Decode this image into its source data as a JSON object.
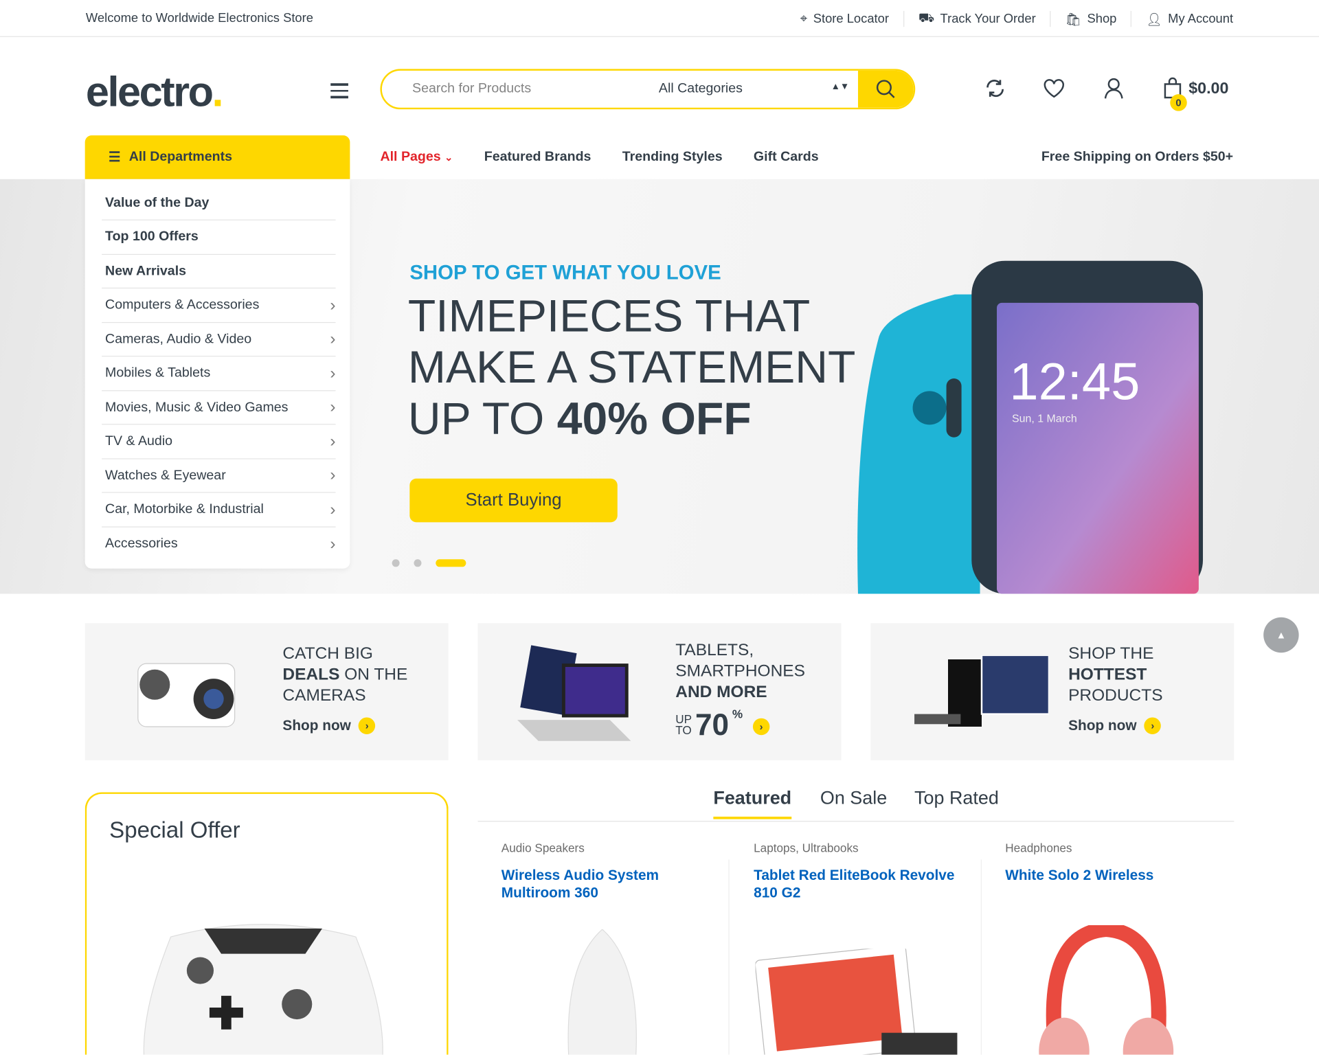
{
  "topbar": {
    "welcome": "Welcome to Worldwide Electronics Store",
    "links": [
      {
        "label": "Store Locator",
        "icon": "map-pin-icon"
      },
      {
        "label": "Track Your Order",
        "icon": "truck-icon"
      },
      {
        "label": "Shop",
        "icon": "shopping-bag-icon"
      },
      {
        "label": "My Account",
        "icon": "user-icon"
      }
    ]
  },
  "header": {
    "logo": "electro",
    "search_placeholder": "Search for Products",
    "category": "All Categories",
    "cart_total": "$0.00",
    "cart_count": "0"
  },
  "nav": {
    "departments": "All Departments",
    "items": [
      "All Pages",
      "Featured Brands",
      "Trending Styles",
      "Gift Cards"
    ],
    "free_shipping": "Free Shipping on Orders $50+"
  },
  "menu": [
    "Value of the Day",
    "Top 100 Offers",
    "New Arrivals",
    "Computers & Accessories",
    "Cameras, Audio & Video",
    "Mobiles & Tablets",
    "Movies, Music & Video Games",
    "TV & Audio",
    "Watches & Eyewear",
    "Car, Motorbike & Industrial",
    "Accessories"
  ],
  "hero": {
    "kicker": "SHOP TO GET WHAT YOU LOVE",
    "line1": "TIMEPIECES THAT",
    "line2": "MAKE A STATEMENT",
    "line3a": "UP TO ",
    "line3b": "40% OFF",
    "button": "Start Buying",
    "phone_time": "12:45",
    "phone_date": "Sun, 1 March",
    "slides": 3,
    "active_slide": 3
  },
  "banners": [
    {
      "l1": "CATCH BIG",
      "l2b": "DEALS",
      "l2": " ON THE",
      "l3": "CAMERAS",
      "shop": "Shop now"
    },
    {
      "l1": "TABLETS,",
      "l2": "SMARTPHONES",
      "l3b": "AND MORE",
      "up": "UP",
      "to": "TO",
      "pct": "70",
      "pcts": "%"
    },
    {
      "l1": "SHOP THE",
      "l2b": "HOTTEST",
      "l3": "PRODUCTS",
      "shop": "Shop now"
    }
  ],
  "special": {
    "title": "Special Offer"
  },
  "tabs": [
    "Featured",
    "On Sale",
    "Top Rated"
  ],
  "products": [
    {
      "category": "Audio Speakers",
      "title": "Wireless Audio System Multiroom 360"
    },
    {
      "category": "Laptops, Ultrabooks",
      "title": "Tablet Red EliteBook Revolve 810 G2"
    },
    {
      "category": "Headphones",
      "title": "White Solo 2 Wireless"
    }
  ],
  "colors": {
    "accent": "#fed700",
    "link": "#0062bd",
    "kicker": "#1fa1d6",
    "active_nav": "#e2232a",
    "text": "#333e48"
  }
}
